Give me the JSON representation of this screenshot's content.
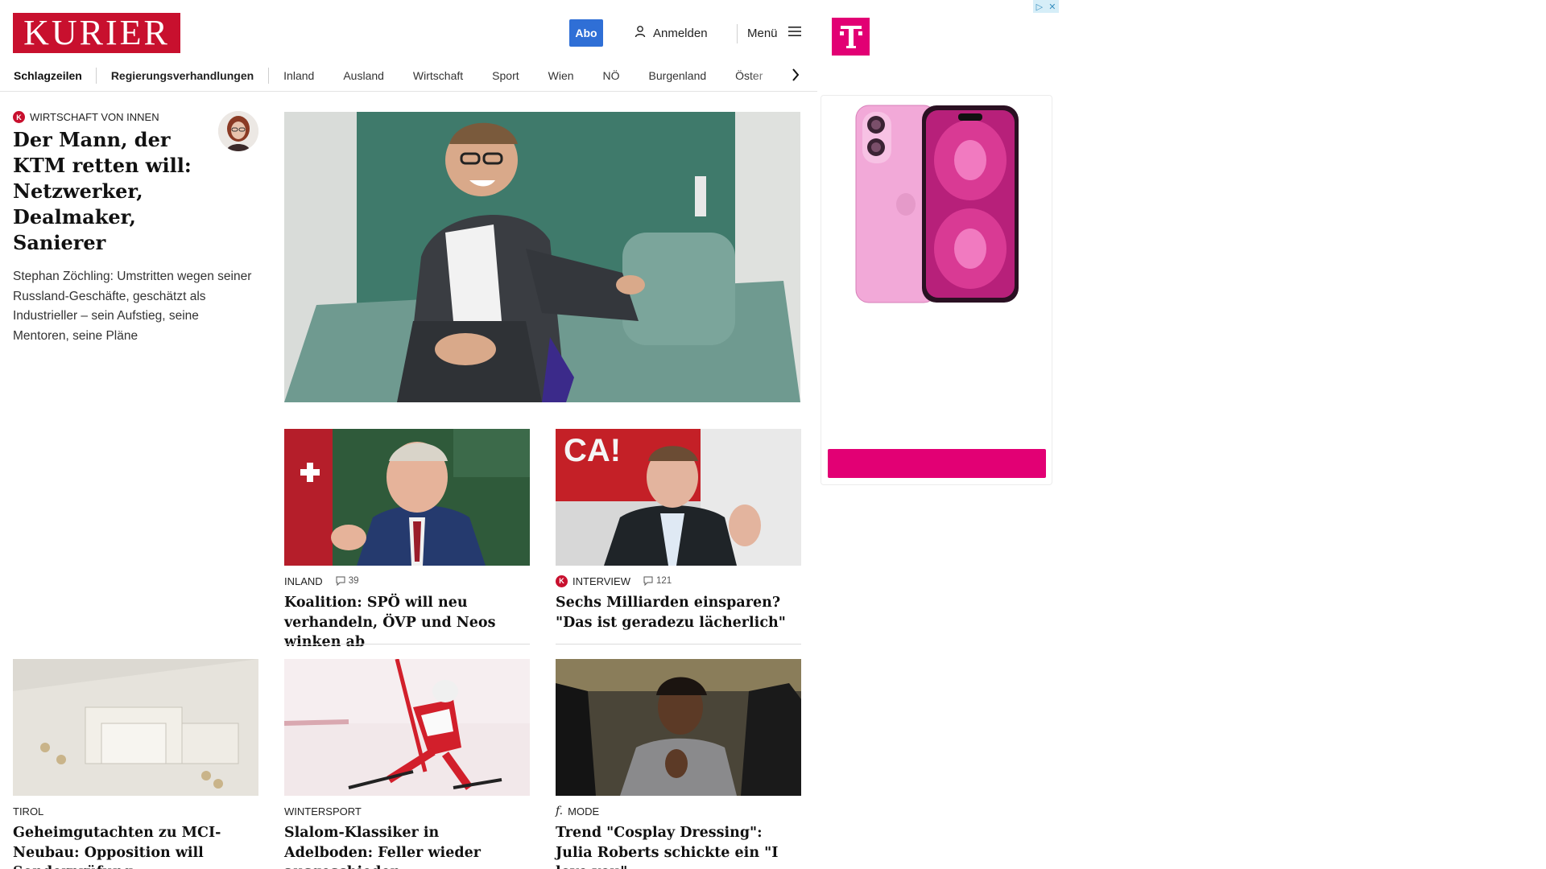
{
  "header": {
    "logo_text": "KURIER",
    "abo_label": "Abo",
    "login_label": "Anmelden",
    "menu_label": "Menü",
    "brand_color": "#c8102e",
    "accent_color": "#2f6fd6"
  },
  "nav": {
    "items": [
      "Schlagzeilen",
      "Regierungsverhandlungen",
      "Inland",
      "Ausland",
      "Wirtschaft",
      "Sport",
      "Wien",
      "NÖ",
      "Burgenland",
      "Öster"
    ]
  },
  "hero": {
    "kicker": "WIRTSCHAFT VON INNEN",
    "kicker_badge": "K",
    "title": "Der Mann, der KTM retten will: Netz­werker, Dealmaker, Sanierer",
    "teaser": "Stephan Zöchling: Umstritten wegen seiner Russland-Geschäfte, geschätzt als Industrieller – sein Aufstieg, seine Mentoren, seine Pläne"
  },
  "cards": [
    {
      "kicker": "INLAND",
      "comments": "39",
      "title": "Koalition: SPÖ will neu verhan­deln, ÖVP und Neos winken ab"
    },
    {
      "kicker": "INTERVIEW",
      "kicker_badge": "K",
      "comments": "121",
      "title": "Sechs Milliarden einsparen? \"Das ist geradezu lächerlich\""
    },
    {
      "kicker": "TIROL",
      "title": "Geheimgutachten zu MCI-Neubau: Opposition will Sonderprüfung"
    },
    {
      "kicker": "WINTERSPORT",
      "title": "Slalom-Klassiker in Adelboden: Feller wieder ausgeschieden"
    },
    {
      "kicker": "MODE",
      "kicker_badge": "f.",
      "title": "Trend \"Cosplay Dressing\": Julia Roberts schickte ein \"I love you\""
    }
  ],
  "ad": {
    "brand_logo": "T",
    "brand_color": "#e20074"
  },
  "icons": {
    "user": "user-icon",
    "menu": "hamburger-icon",
    "comment": "comment-icon",
    "nav_next": "chevron-right-icon"
  }
}
